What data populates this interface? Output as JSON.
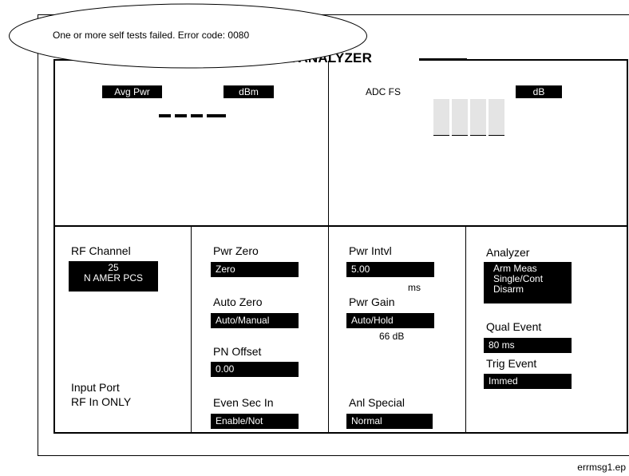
{
  "error_message": "One or more self tests failed. Error code: 0080",
  "screen_title": "CDMA ANALYZER",
  "meters": {
    "avg_pwr_label": "Avg Pwr",
    "avg_pwr_unit": "dBm",
    "adc_label": "ADC FS",
    "adc_unit": "dB"
  },
  "fields": {
    "rf_channel": {
      "label": "RF Channel",
      "value_line1": "25",
      "value_line2": "N AMER PCS"
    },
    "input_port": {
      "label": "Input Port",
      "value": "RF In ONLY"
    },
    "pwr_zero": {
      "label": "Pwr Zero",
      "value": "Zero"
    },
    "auto_zero": {
      "label": "Auto Zero",
      "value": "Auto/Manual"
    },
    "pn_offset": {
      "label": "PN Offset",
      "value": "0.00"
    },
    "even_sec_in": {
      "label": "Even Sec In",
      "value": "Enable/Not"
    },
    "pwr_intvl": {
      "label": "Pwr Intvl",
      "value": "5.00",
      "unit": "ms"
    },
    "pwr_gain": {
      "label": "Pwr Gain",
      "value": "Auto/Hold",
      "readout": "66 dB"
    },
    "anl_special": {
      "label": "Anl Special",
      "value": "Normal"
    },
    "analyzer": {
      "label": "Analyzer",
      "options": [
        "Arm Meas",
        "Single/Cont",
        "Disarm"
      ]
    },
    "qual_event": {
      "label": "Qual Event",
      "value": "80 ms"
    },
    "trig_event": {
      "label": "Trig Event",
      "value": "Immed"
    }
  },
  "figure_label": "errmsg1.ep"
}
